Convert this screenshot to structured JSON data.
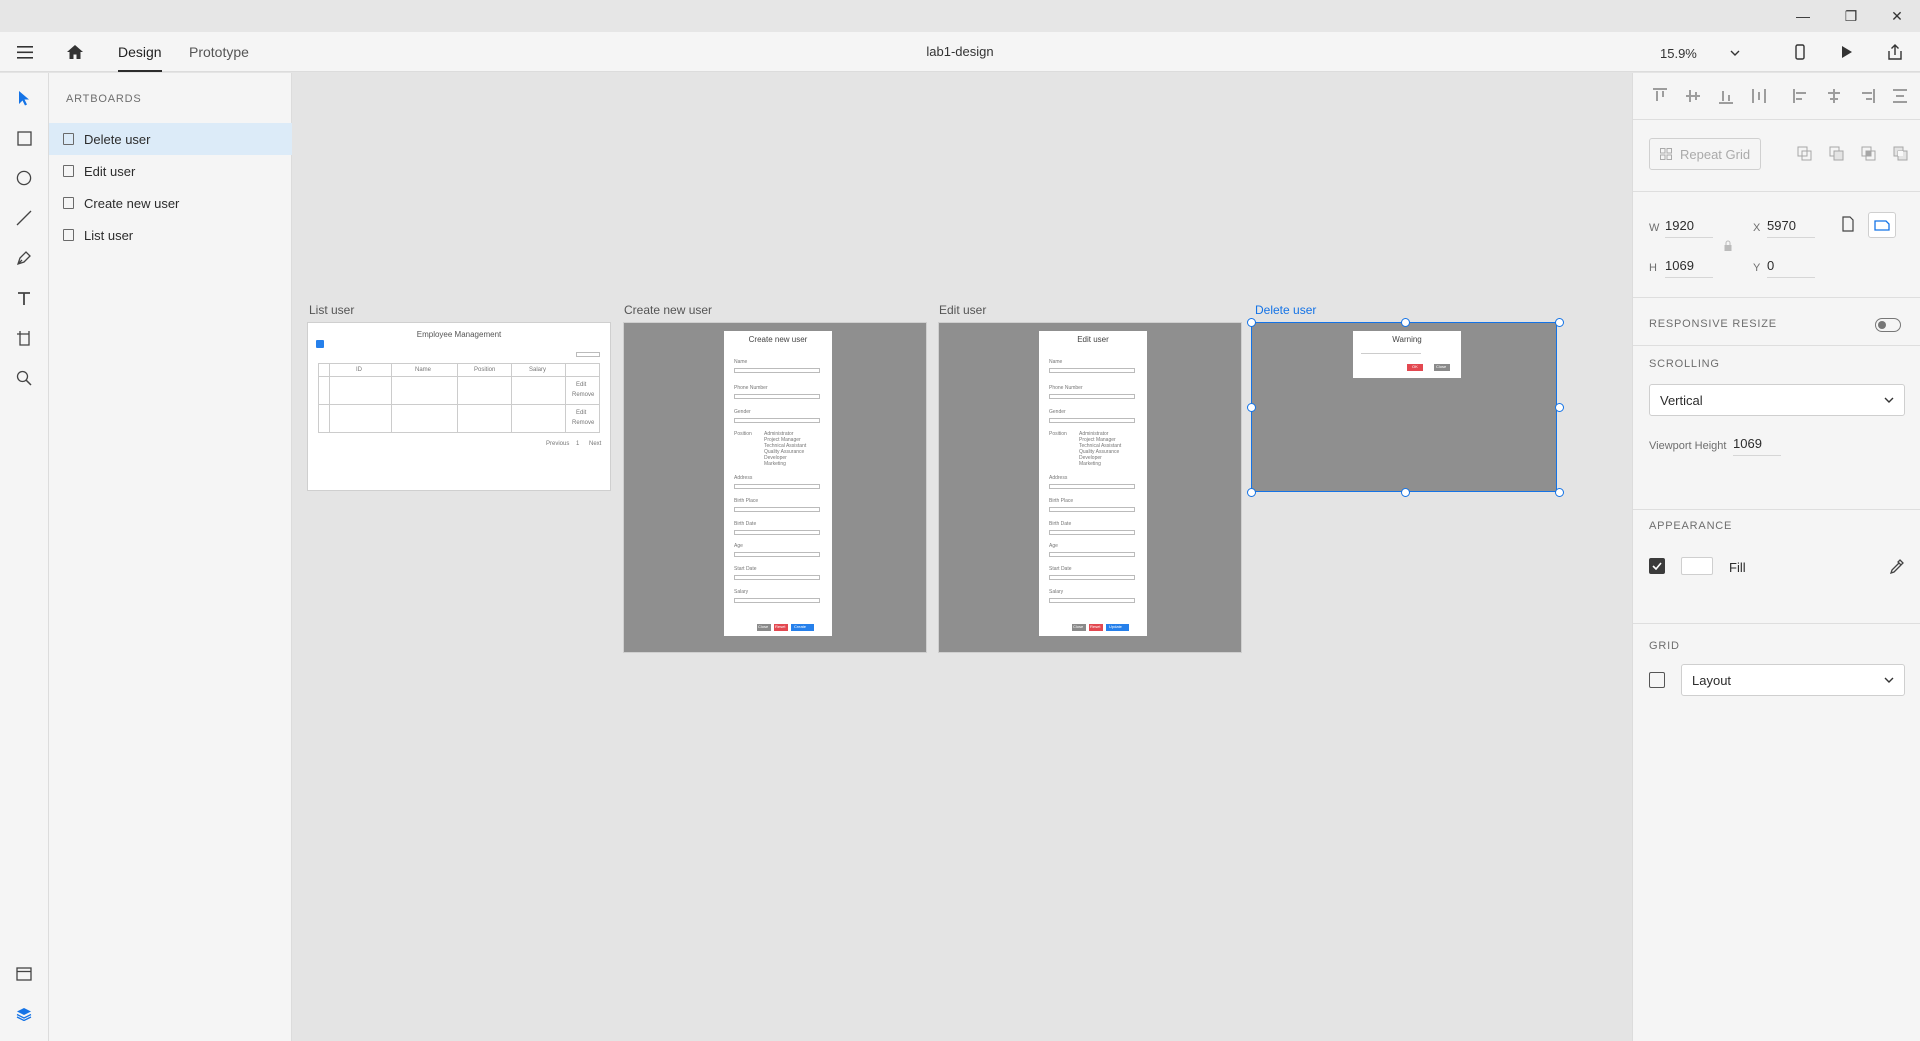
{
  "window": {
    "controls": {
      "minimize": "—",
      "maximize": "❐",
      "close": "✕"
    }
  },
  "topbar": {
    "tabs": [
      {
        "label": "Design"
      },
      {
        "label": "Prototype"
      }
    ],
    "doc_title": "lab1-design",
    "zoom": "15.9%"
  },
  "layers": {
    "title": "ARTBOARDS",
    "items": [
      {
        "label": "Delete user"
      },
      {
        "label": "Edit user"
      },
      {
        "label": "Create new user"
      },
      {
        "label": "List user"
      }
    ]
  },
  "canvas": {
    "artboards": [
      {
        "label": "List user"
      },
      {
        "label": "Create new user"
      },
      {
        "label": "Edit user"
      },
      {
        "label": "Delete user"
      }
    ],
    "list_user": {
      "title": "Employee Management",
      "columns": [
        "ID",
        "Name",
        "Position",
        "Salary"
      ],
      "row_actions": [
        "Edit",
        "Remove"
      ],
      "pagination": [
        "Previous",
        "1",
        "Next"
      ]
    },
    "create_user": {
      "title": "Create new user",
      "fields": [
        "Name",
        "Phone Number",
        "Gender",
        "Position",
        "Address",
        "Birth Place",
        "Birth Date",
        "Age",
        "Start Date",
        "Salary"
      ],
      "positions": [
        "Administrator",
        "Project Manager",
        "Technical Assistant",
        "Quality Assurance",
        "Developer",
        "Marketing"
      ],
      "buttons": [
        "Close",
        "Reset",
        "Create"
      ]
    },
    "edit_user": {
      "title": "Edit user",
      "buttons": [
        "Close",
        "Reset",
        "Update"
      ]
    },
    "delete_user": {
      "title": "Warning",
      "buttons": [
        "OK",
        "Close"
      ]
    }
  },
  "properties": {
    "repeat_grid": "Repeat Grid",
    "w_label": "W",
    "w": "1920",
    "h_label": "H",
    "h": "1069",
    "x_label": "X",
    "x": "5970",
    "y_label": "Y",
    "y": "0",
    "responsive_resize": "RESPONSIVE RESIZE",
    "scrolling_title": "SCROLLING",
    "scrolling_value": "Vertical",
    "viewport_height_label": "Viewport Height",
    "viewport_height": "1069",
    "appearance_title": "APPEARANCE",
    "fill_label": "Fill",
    "grid_title": "GRID",
    "grid_value": "Layout"
  },
  "colors": {
    "accent": "#1473e6",
    "selected_row": "#dcebf8",
    "danger": "#e34850",
    "primary": "#2680eb"
  }
}
